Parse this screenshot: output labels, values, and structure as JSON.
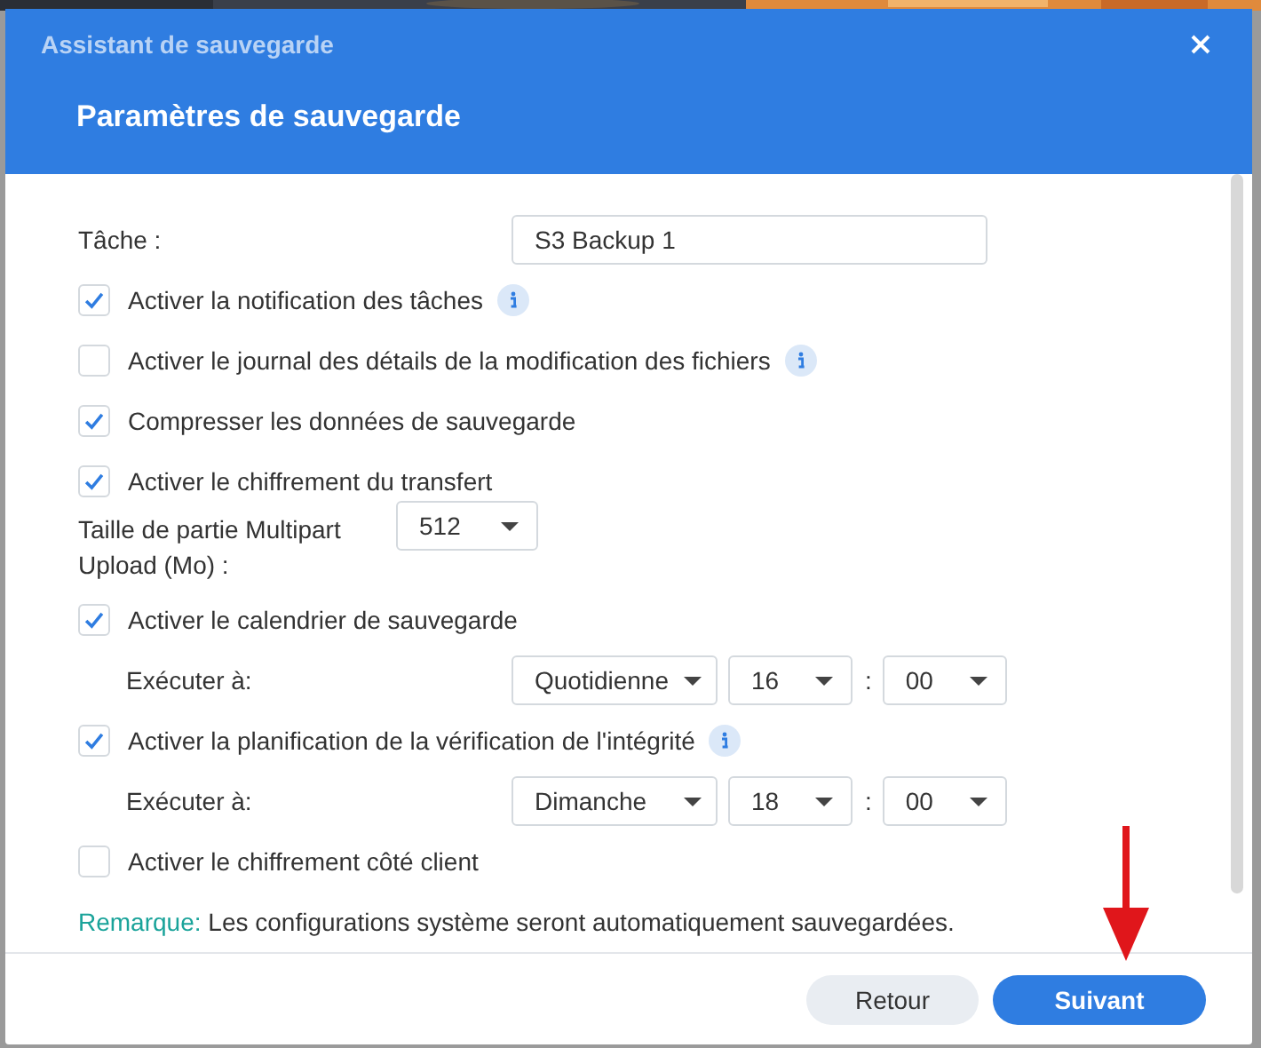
{
  "window": {
    "title": "Assistant de sauvegarde"
  },
  "header": "Paramètres de sauvegarde",
  "settings": [
    {
      "kind": "field",
      "label": "Tâche :",
      "value": "S3 Backup 1"
    },
    {
      "kind": "checkbox",
      "label": "Activer la notification des tâches",
      "checked": true,
      "info": true
    },
    {
      "kind": "checkbox",
      "label": "Activer le journal des détails de la modification des fichiers",
      "checked": false,
      "info": true
    },
    {
      "kind": "checkbox",
      "label": "Compresser les données de sauvegarde",
      "checked": true,
      "info": false
    },
    {
      "kind": "checkbox",
      "label": "Activer le chiffrement du transfert",
      "checked": true,
      "info": false
    },
    {
      "kind": "select",
      "label": "Taille de partie Multipart Upload (Mo) :",
      "value": "512"
    },
    {
      "kind": "checkbox",
      "label": "Activer le calendrier de sauvegarde",
      "checked": true,
      "info": false
    },
    {
      "kind": "schedule",
      "label": "Exécuter à:",
      "selects": [
        "Quotidienne",
        "16",
        "00"
      ],
      "separator": ":"
    },
    {
      "kind": "checkbox",
      "label": "Activer la planification de la vérification de l'intégrité",
      "checked": true,
      "info": true
    },
    {
      "kind": "schedule",
      "label": "Exécuter à:",
      "selects": [
        "Dimanche",
        "18",
        "00"
      ],
      "separator": ":"
    },
    {
      "kind": "checkbox",
      "label": "Activer le chiffrement côté client",
      "checked": false,
      "info": false
    },
    {
      "kind": "note",
      "label": "Remarque:",
      "text": "Les configurations système seront automatiquement sauvegardées."
    }
  ],
  "buttons": [
    {
      "label": "Retour",
      "kind": "secondary"
    },
    {
      "label": "Suivant",
      "kind": "primary"
    }
  ]
}
